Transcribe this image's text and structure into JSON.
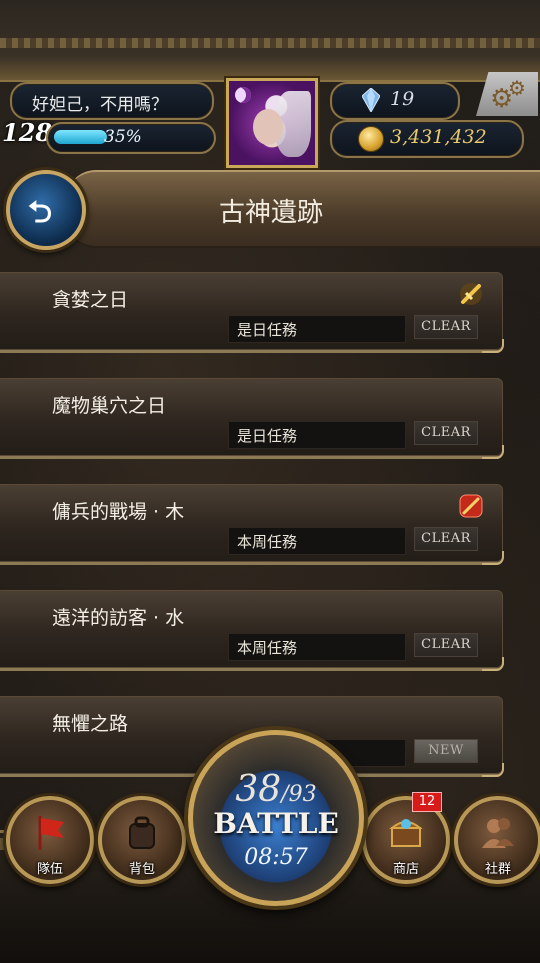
{
  "header": {
    "player_name": "好妲己，不用嗎？",
    "level": "128",
    "xp_percent_label": "35%",
    "xp_fraction": 0.35,
    "gems": "19",
    "coins": "3,431,432"
  },
  "page": {
    "title": "古神遺跡"
  },
  "quests": [
    {
      "name": "貪婪之日",
      "type": "是日任務",
      "status": "CLEAR",
      "icon": "gold-sword-icon"
    },
    {
      "name": "魔物巢穴之日",
      "type": "是日任務",
      "status": "CLEAR",
      "icon": ""
    },
    {
      "name": "傭兵的戰場 · 木",
      "type": "本周任務",
      "status": "CLEAR",
      "icon": "red-sword-icon"
    },
    {
      "name": "遠洋的訪客 · 水",
      "type": "本周任務",
      "status": "CLEAR",
      "icon": ""
    },
    {
      "name": "無懼之路",
      "type": "",
      "status": "NEW",
      "icon": ""
    }
  ],
  "battle": {
    "stamina_current": "38",
    "stamina_max": "/93",
    "label": "BATTLE",
    "timer": "08:57"
  },
  "nav": {
    "team": "隊伍",
    "bag": "背包",
    "shop": "商店",
    "shop_badge": "12",
    "social": "社群"
  },
  "colors": {
    "accent_gold": "#c9a458",
    "xp_blue": "#1ea6d0",
    "badge_red": "#d71a1a"
  }
}
